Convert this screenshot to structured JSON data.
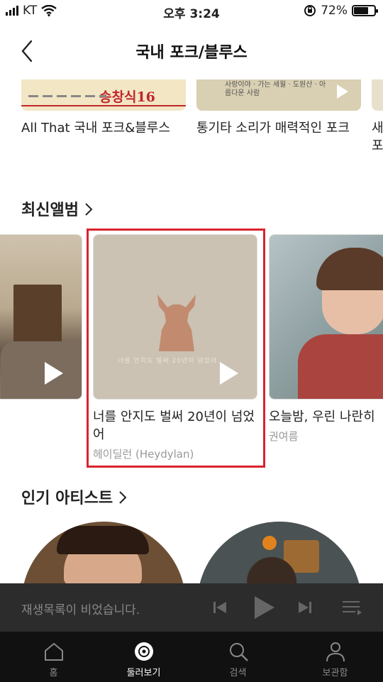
{
  "status": {
    "carrier": "KT",
    "time": "오후 3:24",
    "battery": "72%",
    "battery_level": 0.72
  },
  "header": {
    "title": "국내 포크/블루스"
  },
  "playlists": [
    {
      "title": "All That 국내 포크&블루스",
      "art_text": "송창식16"
    },
    {
      "title": "통기타 소리가 매력적인 포크",
      "art_text": "사랑이야 · 가는 세월 · 도원산 · 아름다운 사람"
    },
    {
      "title": "새 포"
    }
  ],
  "latest": {
    "heading": "최신앨범",
    "albums": [
      {
        "title": "",
        "artist": ""
      },
      {
        "title": "너를 안지도 벌써 20년이 넘었어",
        "artist": "헤이딜런 (Heydylan)",
        "art_text": "너를 안지도 벌써 20년이 넘었어"
      },
      {
        "title": "오늘밤, 우린 나란히",
        "artist": "권여름"
      }
    ]
  },
  "artists": {
    "heading": "인기 아티스트"
  },
  "player": {
    "empty_message": "재생목록이 비었습니다."
  },
  "tabs": [
    {
      "label": "홈",
      "icon": "home-icon"
    },
    {
      "label": "둘러보기",
      "icon": "browse-icon"
    },
    {
      "label": "검색",
      "icon": "search-icon"
    },
    {
      "label": "보관함",
      "icon": "library-icon"
    }
  ],
  "colors": {
    "highlight": "#d9232e",
    "player_bg": "#2c2c2c",
    "tabbar_bg": "#111111"
  }
}
